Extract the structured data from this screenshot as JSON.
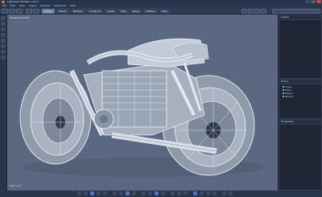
{
  "app": {
    "title": "Lightwave Modeler 11.6.3"
  },
  "menu": [
    "File",
    "Edit",
    "View",
    "Select",
    "Window",
    "Additional",
    "Help"
  ],
  "modes": [
    {
      "label": "Create",
      "active": true
    },
    {
      "label": "Modify",
      "active": false
    },
    {
      "label": "Multiply",
      "active": false
    },
    {
      "label": "Construct",
      "active": false
    },
    {
      "label": "Detail",
      "active": false
    },
    {
      "label": "Map",
      "active": false
    },
    {
      "label": "Setup",
      "active": false
    },
    {
      "label": "Utilities",
      "active": false
    },
    {
      "label": "View",
      "active": false
    }
  ],
  "viewport": {
    "label": "Perspective Wire",
    "footer": "Grid: 1 m"
  },
  "panels": {
    "layers": {
      "title": "Layers"
    },
    "scene": {
      "title": "Scene",
      "items": [
        "Engine",
        "Frame",
        "Wheel_F",
        "Wheel_R"
      ]
    },
    "props": {
      "title": "Properties"
    }
  },
  "window_controls": {
    "minimize": "_",
    "maximize": "□",
    "close": "x"
  },
  "colors": {
    "viewport_bg": "#5a6780",
    "wire": "#e3e8f0",
    "accent": "#4a78c4"
  }
}
